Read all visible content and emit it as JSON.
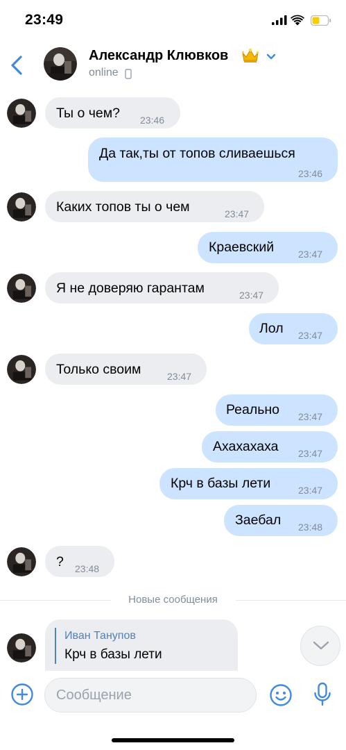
{
  "status_bar": {
    "time": "23:49"
  },
  "header": {
    "contact_name": "Александр Клювков",
    "status": "online",
    "crown_emoji": "👑"
  },
  "messages": [
    {
      "direction": "in",
      "text": "Ты о чем?",
      "time": "23:46"
    },
    {
      "direction": "out",
      "text": "Да так,ты от топов сливаешься",
      "time": "23:46"
    },
    {
      "direction": "in",
      "text": "Каких топов ты о чем",
      "time": "23:47"
    },
    {
      "direction": "out",
      "text": "Краевский",
      "time": "23:47"
    },
    {
      "direction": "in",
      "text": "Я не доверяю гарантам",
      "time": "23:47"
    },
    {
      "direction": "out",
      "text": "Лол",
      "time": "23:47"
    },
    {
      "direction": "in",
      "text": "Только своим",
      "time": "23:47"
    },
    {
      "direction": "out",
      "text": "Реально",
      "time": "23:47"
    },
    {
      "direction": "out",
      "text": "Ахахахаха",
      "time": "23:47"
    },
    {
      "direction": "out",
      "text": "Крч в базы лети",
      "time": "23:47"
    },
    {
      "direction": "out",
      "text": "Заебал",
      "time": "23:48"
    },
    {
      "direction": "in",
      "text": "?",
      "time": "23:48"
    }
  ],
  "divider": {
    "label": "Новые сообщения"
  },
  "reply_message": {
    "author": "Иван Танупов",
    "quoted_text": "Крч в базы лети"
  },
  "composer": {
    "placeholder": "Сообщение"
  },
  "colors": {
    "accent": "#3f8ae0",
    "incoming_bubble": "#ebedf0",
    "outgoing_bubble": "#cce4ff",
    "secondary_text": "#818c99",
    "reply_author": "#5181b8"
  },
  "icons": {
    "back": "chevron-left-icon",
    "expand": "chevron-down-icon",
    "attach": "plus-circle-icon",
    "emoji": "smile-icon",
    "voice": "microphone-icon",
    "scroll": "chevron-down-icon",
    "device": "phone-icon"
  }
}
